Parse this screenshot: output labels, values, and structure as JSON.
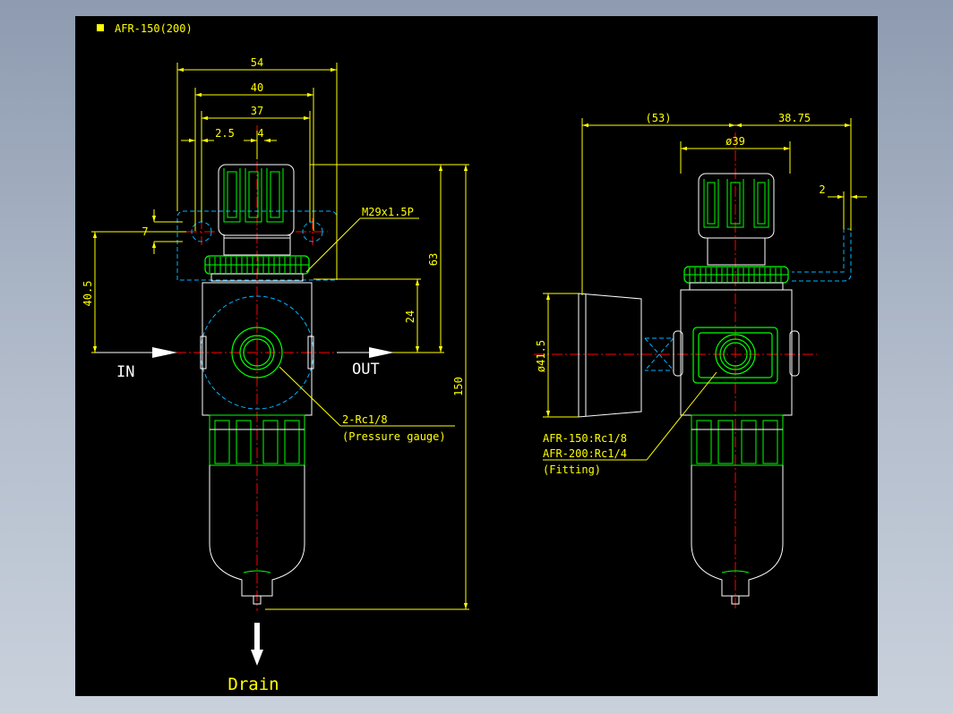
{
  "title": "AFR-150(200)",
  "colors": {
    "background": "#000000",
    "outline": "#ffffff",
    "part": "#00ff00",
    "dimension": "#ffff00",
    "center": "#ff0000",
    "hidden": "#00b4ff",
    "title_marker": "#ffff00"
  },
  "front_view": {
    "dims": {
      "d54": "54",
      "d40": "40",
      "d37": "37",
      "d2_5": "2.5",
      "d4": "4",
      "d7": "7",
      "d40_5": "40.5",
      "d63": "63",
      "d24": "24",
      "d150": "150"
    },
    "thread": "M29x1.5P",
    "in_label": "IN",
    "out_label": "OUT",
    "gauge_port": "2-Rc1/8",
    "gauge_note": "(Pressure gauge)",
    "drain_label": "Drain"
  },
  "side_view": {
    "dims": {
      "d53": "(53)",
      "d38_75": "38.75",
      "d39": "ø39",
      "d2": "2",
      "d41_5": "ø41.5"
    },
    "fitting_150": "AFR-150:Rc1/8",
    "fitting_200": "AFR-200:Rc1/4",
    "fitting_note": "(Fitting)"
  }
}
